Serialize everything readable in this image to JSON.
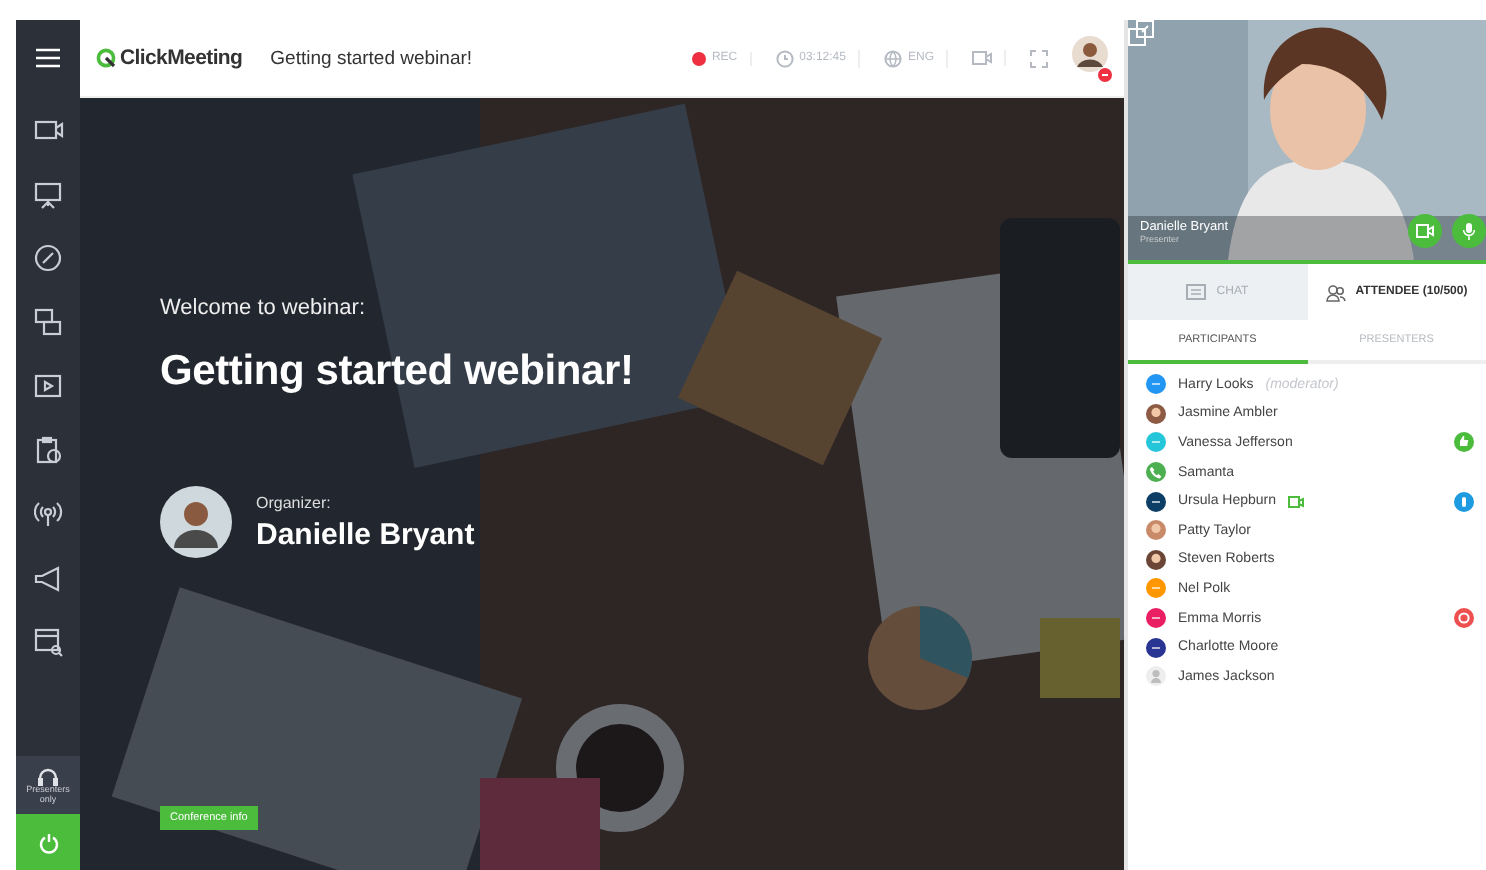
{
  "topbar": {
    "logo": "ClickMeeting",
    "title": "Getting started webinar!",
    "recording": {
      "label": "REC",
      "on": true
    },
    "timer": "03:12:45",
    "language": "ENG"
  },
  "sidebar": {
    "items": [
      {
        "kind": "camera"
      },
      {
        "kind": "presentation"
      },
      {
        "kind": "pencil"
      },
      {
        "kind": "screens"
      },
      {
        "kind": "video"
      },
      {
        "kind": "clipboard"
      },
      {
        "kind": "broadcast"
      },
      {
        "kind": "megaphone"
      },
      {
        "kind": "browser"
      }
    ],
    "presenters_only": "Presenters only"
  },
  "stage": {
    "welcome": "Welcome to webinar:",
    "title": "Getting started webinar!",
    "organizer_label": "Organizer:",
    "organizer_name": "Danielle Bryant",
    "conference_button": "Conference info"
  },
  "video": {
    "name": "Danielle Bryant",
    "role": "Presenter"
  },
  "tabs": [
    {
      "label": "CHAT",
      "selected": false
    },
    {
      "label": "ATTENDEE (10/500)",
      "selected": true
    }
  ],
  "subtabs": [
    {
      "label": "PARTICIPANTS",
      "selected": true
    },
    {
      "label": "PRESENTERS",
      "selected": false
    }
  ],
  "participants": [
    {
      "name": "Harry Looks",
      "note": "(moderator)",
      "kind": "initials",
      "color": "#2196f3",
      "camera": false
    },
    {
      "name": "Jasmine Ambler",
      "color": "#8d5a44",
      "camera": false
    },
    {
      "name": "Vanessa Jefferson",
      "kind": "initials",
      "color": "#26c6da",
      "camera": false,
      "badge": {
        "kind": "like"
      }
    },
    {
      "name": "Samanta",
      "kind": "phone",
      "color": "#4caf50",
      "camera": false
    },
    {
      "name": "Ursula Hepburn",
      "kind": "initials",
      "color": "#0d3f66",
      "camera": true,
      "badge": {
        "kind": "hand"
      }
    },
    {
      "name": "Patty Taylor",
      "color": "#c98a6a",
      "camera": false
    },
    {
      "name": "Steven Roberts",
      "color": "#6b4535",
      "camera": false
    },
    {
      "name": "Nel Polk",
      "kind": "initials",
      "color": "#ff9800",
      "camera": false
    },
    {
      "name": "Emma Morris",
      "kind": "initials",
      "color": "#e91e63",
      "camera": false,
      "badge": {
        "kind": "stop"
      }
    },
    {
      "name": "Charlotte Moore",
      "kind": "initials",
      "color": "#283593",
      "camera": false
    },
    {
      "name": "James Jackson",
      "kind": "person",
      "color": "#bdbdbd",
      "camera": false
    }
  ]
}
